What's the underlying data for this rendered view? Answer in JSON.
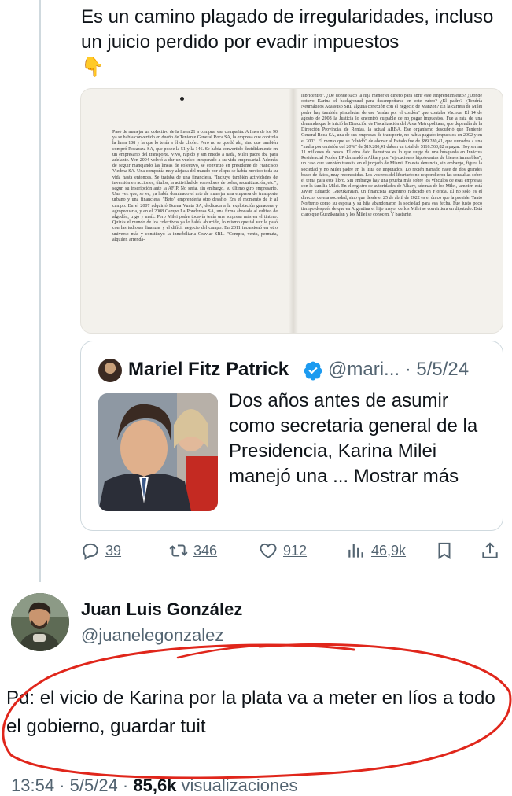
{
  "tweet": {
    "text": "Es un camino plagado de irregularidades, incluso un juicio perdido por evadir impuestos",
    "emoji": "👇"
  },
  "book_page": {
    "left_column": "Pasó de manejar un colectivo de la línea 21 a comprar esa compañía. A fines de los 90 ya se había convertido en dueño de Teniente General Roca SA, la empresa que controla la línea 108 y la que lo tenía a él de chofer. Pero no se quedó ahí, sino que también compró Rocaraza SA, que posee la 51 y la 146. Se había convertido decididamente en un empresario del transporte. Vivo, rápido y sin miedo a nada, Milei padre iba para adelante. Yen 2004 volvió a dar un vuelco inesperado a su vida empresarial. Además de seguir manejando las líneas de colectivo, se convirtió en presidente de Francisco Viedma SA. Una compañía muy alejada del mundo por el que se había movido toda su vida hasta entonces. Se trataba de una financiera. \"Incluye también actividades de inversión en acciones, títulos, la actividad de corredores de bolsa, securitización, etc.\", según su inscripción ante la AFIP. No sería, sin embargo, su último giro empresario. Una vez que, se ve, ya había dominado el arte de manejar una empresa de transporte urbano y una financiera, \"Beto\" emprendería otro desafío. Era el momento de ir al campo. En el 2007 adquirió Buena Vunta SA, dedicada a la explotación ganadera y agropecuaria, y en el 2008 Campo La Ponderosa SA, una firma abocada al cultivo de algodón, trigo y maíz. Pero Milei padre todavía tenía una sorpresa más en el tintero. Quizás el mundo de los colectivos ya lo había aburrido, lo mismo que tal vez le pasó con las tediosas finanzas y el difícil negocio del campo. En 2011 incursionó en otro universo más y constituyó la inmobiliaria Graviar SRL. \"Compra, venta, permuta, alquiler, arrenda-",
    "right_column": "lubricentro\". ¿De dónde sacó la hija menor el dinero para abrir este emprendimiento? ¿Dónde obtuvo Karina el background para desempeñarse en este rubro? ¿El padre? ¿Tendría Neumáticos Acassuso SRL alguna conexión con el negocio de Manzon? En la carrera de Milei padre hay también pinceladas de ese \"andar por el cordón\" que contaba Vacirca. El 14 de agosto de 2008 la Justicia lo encontró culpable de no pagar impuestos. Fue a raíz de una demanda que le inició la Dirección de Fiscalización del Área Metropolitana, que dependía de la Dirección Provincial de Rentas, la actual ARBA. Ese organismo descubrió que Teniente General Roca SA, una de sus empresas de transporte, no había pagado impuestos en 2002 y en el 2003. El monto que se \"olvidó\" de abonar al Estado fue de $99.280,41, que sumados a una \"multa por omisión del 20%\" de $19.280,41 daban un total de $118.560,82 a pagar. Hoy serían 11 millones de pesos. El otro dato llamativo es lo que surge de una búsqueda en Invictus Residencial Pooler LP demandó a Alkary por \"ejecuciones hipotecarias de bienes inmuebles\", un caso que también transita en el juzgado de Miami. En esta denuncia, sin embargo, figura la sociedad y no Milei padre en la lista de imputados. Lo recién narrado nace de dos grandes bases de datos, muy reconocidas. Los voceros del libertario no respondieron las consultas sobre el tema para este libro. Sin embargo hay una prueba más sobre los vínculos de esas empresas con la familia Milei. En el registro de autoridades de Alkary, además de los Milei, también está Javier Eduardo Guezikaraian, un financista argentino radicado en Florida. Él no solo es el director de esa sociedad, sino que desde el 25 de abril de 2022 es el único que la preside. Tanto Norberto como su esposa y su hija abandonaron la sociedad para esa fecha. Fue justo poco tiempo después de que en Argentina el hijo mayor de los Milei se convirtiera en diputado. Está claro que Guezikaraian y los Milei se conocen. Y bastante."
  },
  "quote": {
    "name": "Mariel Fitz Patrick",
    "handle": "@mari...",
    "dot": "·",
    "date": "5/5/24",
    "text": "Dos años antes de asumir como secretaria general de la Presidencia, Karina Milei manejó una ... Mostrar más"
  },
  "actions": {
    "replies": "39",
    "retweets": "346",
    "likes": "912",
    "views": "46,9k"
  },
  "reply": {
    "name": "Juan Luis González",
    "handle": "@juanelegonzalez",
    "text": "Pd: el vicio de Karina por la plata va a meter en líos a todo el gobierno, guardar tuit",
    "time": "13:54",
    "date": "5/5/24",
    "views_count": "85,6k",
    "views_label": "visualizaciones"
  },
  "colors": {
    "text": "#0f1419",
    "secondary": "#536471",
    "verified": "#1d9bf0",
    "annotation": "#e0261b"
  }
}
